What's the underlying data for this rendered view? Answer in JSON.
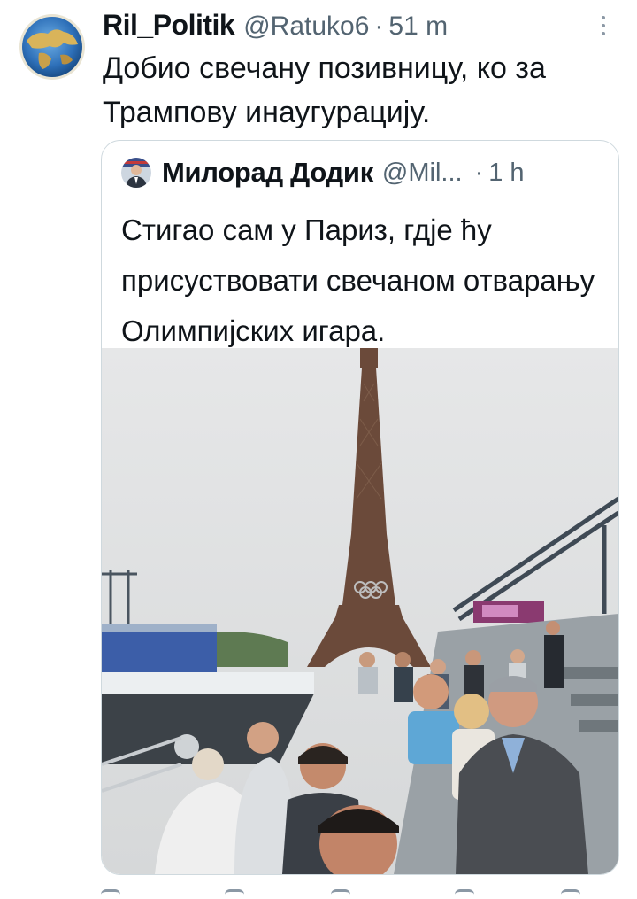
{
  "tweet": {
    "display_name": "Ril_Politik",
    "handle": "@Ratuko6",
    "separator": "·",
    "time": "51 m",
    "text": "Добио свечану позивницу, ко за Трампову инаугурацију."
  },
  "quoted_tweet": {
    "display_name": "Милорад Додик",
    "handle": "@Mil...",
    "separator": "·",
    "time": "1 h",
    "text": "Стигао сам у Париз, гдје ћу присуствовати свечаном отварању Олимпијских игара."
  },
  "icons": {
    "more": "more-vertical-icon",
    "reply": "reply-icon",
    "retweet": "retweet-icon",
    "like": "like-icon",
    "views": "views-icon",
    "share": "share-icon"
  },
  "colors": {
    "text_primary": "#0f1419",
    "text_secondary": "#536471",
    "border": "#cfd9de"
  }
}
